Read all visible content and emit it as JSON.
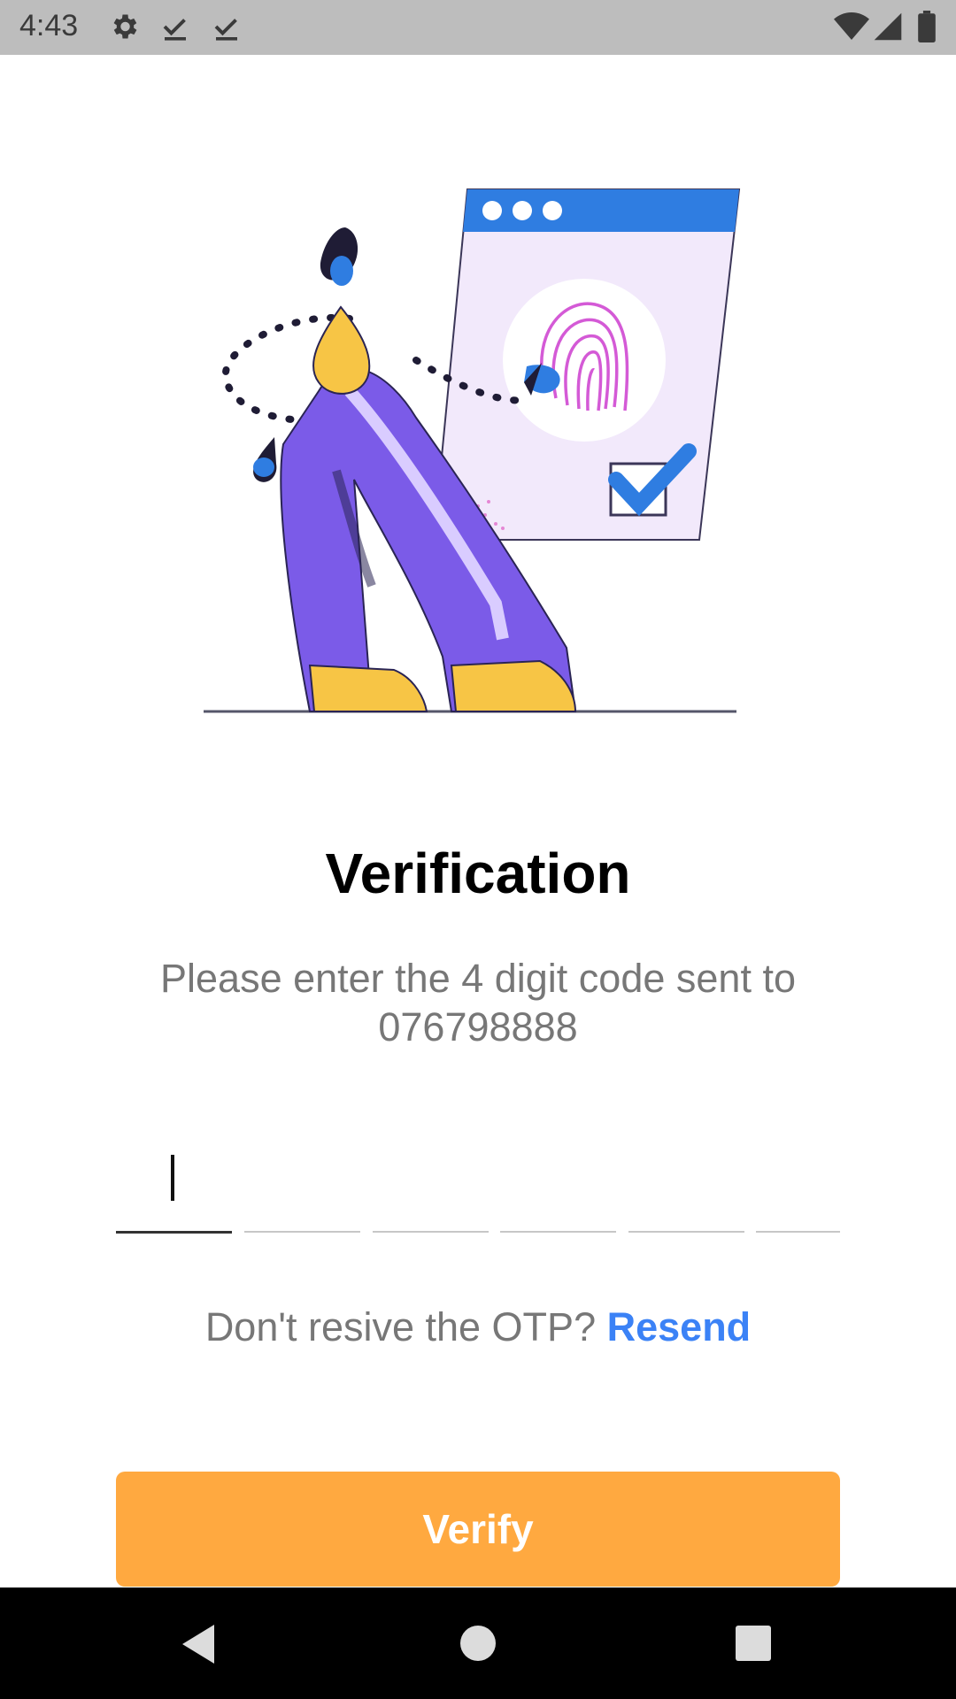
{
  "status_bar": {
    "time": "4:43",
    "icons_left": [
      "gear-icon",
      "download-done-icon",
      "download-done-icon"
    ],
    "icons_right": [
      "wifi-icon",
      "cell-signal-icon",
      "battery-icon"
    ]
  },
  "screen": {
    "title": "Verification",
    "subtitle": "Please enter the 4 digit code sent to 076798888",
    "otp": {
      "cells": 6,
      "values": [
        "",
        "",
        "",
        "",
        "",
        ""
      ],
      "active_index": 0
    },
    "resend_prompt": "Don't resive the OTP?",
    "resend_label": "Resend",
    "verify_label": "Verify"
  },
  "colors": {
    "accent": "#ffa940",
    "link": "#3b82f6",
    "illustration_purple": "#7b5be8",
    "illustration_blue": "#2f7de1",
    "illustration_yellow": "#f7c545"
  },
  "nav_bar": {
    "buttons": [
      "back-icon",
      "home-icon",
      "recents-icon"
    ]
  }
}
